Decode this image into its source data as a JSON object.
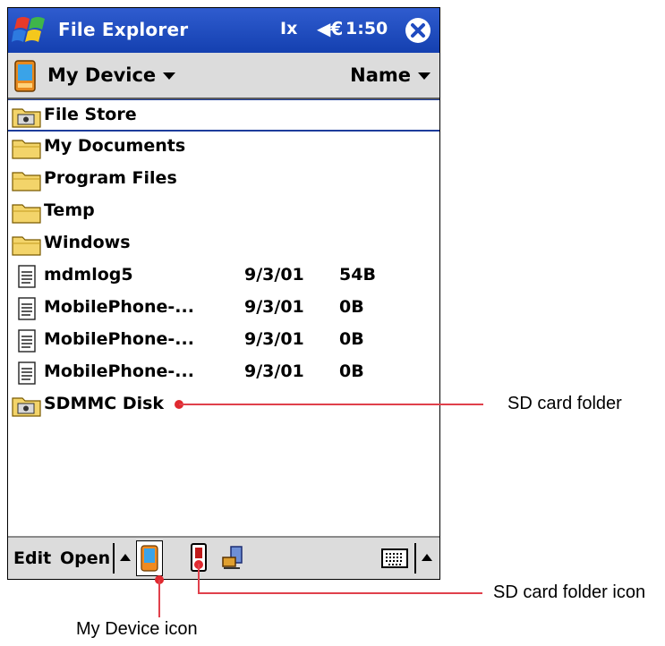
{
  "titlebar": {
    "app_title": "File Explorer",
    "connectivity_symbol": "Ix",
    "volume_symbol": "◀€",
    "clock": "1:50"
  },
  "folderbar": {
    "location": "My Device",
    "sort": "Name"
  },
  "files": [
    {
      "name": "File Store",
      "date": "",
      "size": "",
      "icon": "storage-folder-icon"
    },
    {
      "name": "My Documents",
      "date": "",
      "size": "",
      "icon": "folder-icon"
    },
    {
      "name": "Program Files",
      "date": "",
      "size": "",
      "icon": "folder-icon"
    },
    {
      "name": "Temp",
      "date": "",
      "size": "",
      "icon": "folder-icon"
    },
    {
      "name": "Windows",
      "date": "",
      "size": "",
      "icon": "folder-icon"
    },
    {
      "name": "mdmlog5",
      "date": "9/3/01",
      "size": "54B",
      "icon": "document-icon"
    },
    {
      "name": "MobilePhone-...",
      "date": "9/3/01",
      "size": "0B",
      "icon": "document-icon"
    },
    {
      "name": "MobilePhone-...",
      "date": "9/3/01",
      "size": "0B",
      "icon": "document-icon"
    },
    {
      "name": "MobilePhone-...",
      "date": "9/3/01",
      "size": "0B",
      "icon": "document-icon"
    },
    {
      "name": "SDMMC Disk",
      "date": "",
      "size": "",
      "icon": "storage-folder-icon"
    }
  ],
  "bottombar": {
    "edit": "Edit",
    "open": "Open"
  },
  "callouts": {
    "sd_card_folder": "SD card folder",
    "sd_card_folder_icon": "SD card folder icon",
    "my_device_icon": "My Device icon"
  },
  "colors": {
    "titlebar": "#1f4bc0",
    "callout": "#e0292f",
    "selection": "#1d3d9c"
  }
}
